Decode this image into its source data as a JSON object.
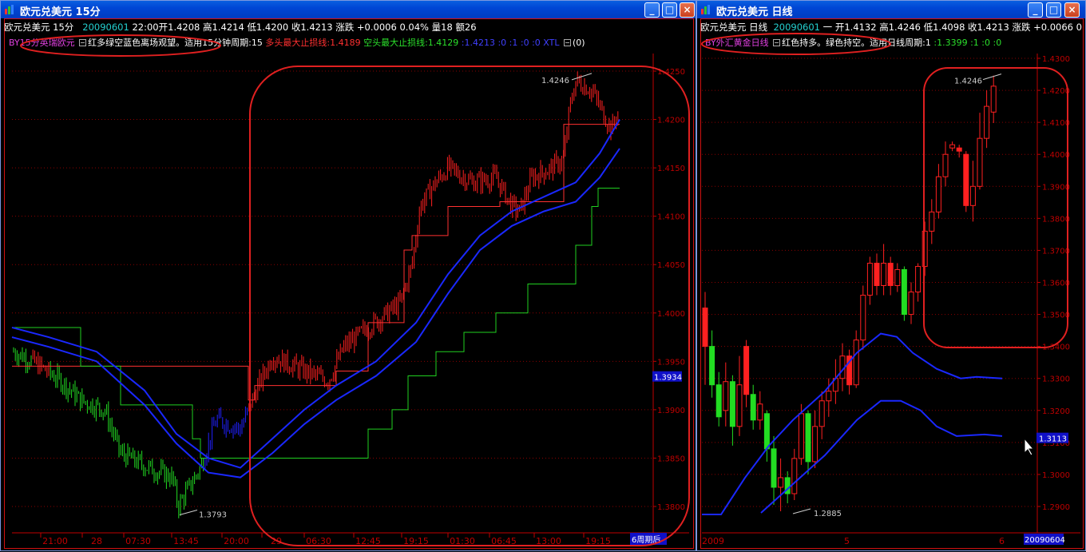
{
  "left_window": {
    "title": "欧元兑美元  15分",
    "info": {
      "name": "欧元兑美元  15分",
      "date": "20090601",
      "time": "22:00",
      "open": "开1.4208",
      "high": "高1.4214",
      "low": "低1.4200",
      "close": "收1.4213",
      "change_label": "涨跌",
      "change": "+0.0006",
      "change_pct": "0.04%",
      "volume": "量18",
      "amount": "额26"
    },
    "indicator": {
      "name": "BY15分英瑞欧元",
      "desc": "红多绿空蓝色离场观望。适用15分钟周期:15",
      "long_stop": "多头最大止损线:1.4189",
      "short_stop": "空头最大止损线:1.4129",
      "last": ":1.4213 :0 :1 :0 :0 XTL",
      "count": "(0)"
    },
    "y_ticks": [
      "1.4250",
      "1.4200",
      "1.4150",
      "1.4100",
      "1.4050",
      "1.4000",
      "1.3950",
      "1.3900",
      "1.3850",
      "1.3800"
    ],
    "current_price": "1.3934",
    "high_annotation": "1.4246",
    "low_annotation": "1.3793",
    "x_ticks": [
      "21:00",
      "28",
      "07:30",
      "13:45",
      "20:00",
      "29",
      "06:30",
      "12:45",
      "19:15",
      "01:30",
      "06:45",
      "13:00",
      "19:15"
    ],
    "period_tag": "6周期后",
    "colors": {
      "up": "#ff2020",
      "down": "#22dd22",
      "neutral": "#2020ff",
      "ma": "#1a28ff",
      "stop_long": "#ff3030",
      "stop_short": "#20d020",
      "annotation": "#e02020",
      "grid": "#8a0000"
    }
  },
  "right_window": {
    "title": "欧元兑美元  日线",
    "info": {
      "name": "欧元兑美元  日线",
      "date": "20090601",
      "weekday": "一",
      "open": "开1.4132",
      "high": "高1.4246",
      "low": "低1.4098",
      "close": "收1.4213",
      "change_label": "涨跌",
      "change": "+0.0066",
      "change_pct": "0"
    },
    "indicator": {
      "name": "BY外汇黄金日线",
      "desc": "红色持多。绿色持空。适用日线周期:1",
      "last": ":1.3399 :1 :0 :0"
    },
    "y_ticks": [
      "1.4300",
      "1.4200",
      "1.4100",
      "1.4000",
      "1.3900",
      "1.3800",
      "1.3700",
      "1.3600",
      "1.3500",
      "1.3400",
      "1.3300",
      "1.3200",
      "1.3100",
      "1.3000",
      "1.2900"
    ],
    "current_price": "1.3113",
    "high_annotation": "1.4246",
    "low_annotation": "1.2885",
    "x_ticks": [
      "2009",
      "5",
      "6"
    ],
    "date_tag": "20090604"
  }
}
